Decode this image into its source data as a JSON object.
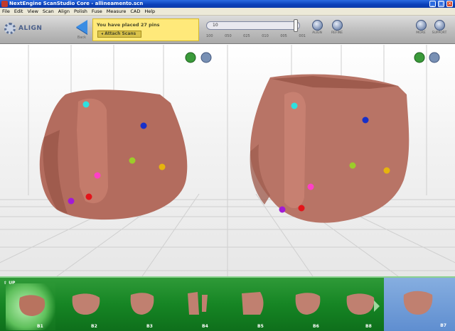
{
  "window": {
    "title": "NextEngine ScanStudio Core - allineamento.scn",
    "minimize": "_",
    "maximize": "□",
    "close": "×"
  },
  "menu": [
    "File",
    "Edit",
    "View",
    "Scan",
    "Align",
    "Polish",
    "Fuse",
    "Measure",
    "CAD",
    "Help"
  ],
  "toolbar": {
    "mode_label": "ALIGN",
    "back_label": "Back",
    "pin_message": "You have placed 27 pins",
    "attach_label": "Attach Scans",
    "slider_value": "10",
    "slider_ticks": [
      "100",
      "050",
      "025",
      "010",
      "005",
      "001"
    ],
    "align_label": "ALIGN",
    "refine_label": "REFINE",
    "more_label": "MORE",
    "support_label": "SUPPORT"
  },
  "strip": {
    "up_label": "UP",
    "items": [
      {
        "label": "B1",
        "selected": true
      },
      {
        "label": "B2"
      },
      {
        "label": "B3"
      },
      {
        "label": "B4"
      },
      {
        "label": "B5"
      },
      {
        "label": "B6"
      },
      {
        "label": "B8"
      }
    ],
    "active": {
      "label": "B7"
    }
  },
  "colors": {
    "accent": "#2b6be0",
    "info_panel": "#ffe97a",
    "strip_green": "#168524",
    "active_blue": "#6f9cd8",
    "scan": "#b56a5a"
  }
}
